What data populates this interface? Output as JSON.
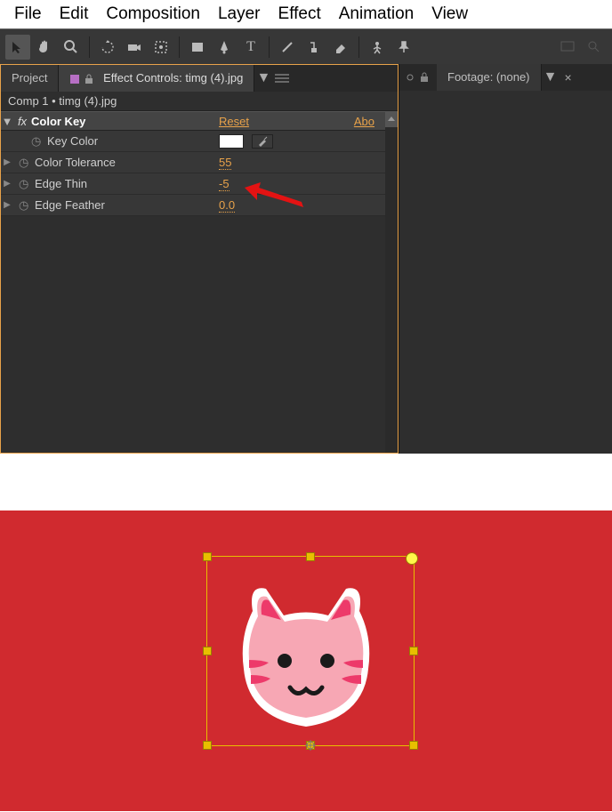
{
  "menu": {
    "file": "File",
    "edit": "Edit",
    "composition": "Composition",
    "layer": "Layer",
    "effect": "Effect",
    "animation": "Animation",
    "view": "View"
  },
  "tabs": {
    "project": "Project",
    "effect_controls": "Effect Controls: timg (4).jpg",
    "footage": "Footage: (none)"
  },
  "breadcrumb": "Comp 1 • timg (4).jpg",
  "effect": {
    "name": "Color Key",
    "reset": "Reset",
    "about": "Abo"
  },
  "props": {
    "key_color": "Key Color",
    "color_tolerance": "Color Tolerance",
    "color_tolerance_val": "55",
    "edge_thin": "Edge Thin",
    "edge_thin_val": "-5",
    "edge_feather": "Edge Feather",
    "edge_feather_val": "0.0"
  }
}
